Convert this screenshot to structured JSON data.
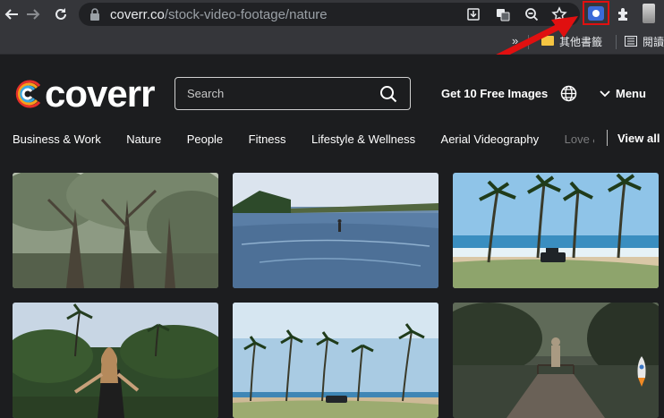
{
  "browser": {
    "url_host": "coverr.co",
    "url_path": "/stock-video-footage/nature",
    "bookmarks": {
      "overflow": "»",
      "folder_label": "其他書籤",
      "reading_list_label": "閱讀"
    }
  },
  "site": {
    "logo_text": "coverr",
    "search_placeholder": "Search",
    "promo_label": "Get 10 Free Images",
    "menu_label": "Menu"
  },
  "categories": [
    "Business & Work",
    "Nature",
    "People",
    "Fitness",
    "Lifestyle & Wellness",
    "Aerial Videography",
    "Love & R"
  ],
  "view_all_label": "View all",
  "thumbnails": [
    {
      "scene": "forest-trees"
    },
    {
      "scene": "person-in-lake"
    },
    {
      "scene": "palm-beach-jeep"
    },
    {
      "scene": "woman-in-jungle"
    },
    {
      "scene": "palm-beach-car"
    },
    {
      "scene": "dock-at-dusk"
    }
  ],
  "colors": {
    "highlight": "#e01010",
    "page_bg": "#1c1d1f",
    "chrome_bg": "#35363a"
  }
}
